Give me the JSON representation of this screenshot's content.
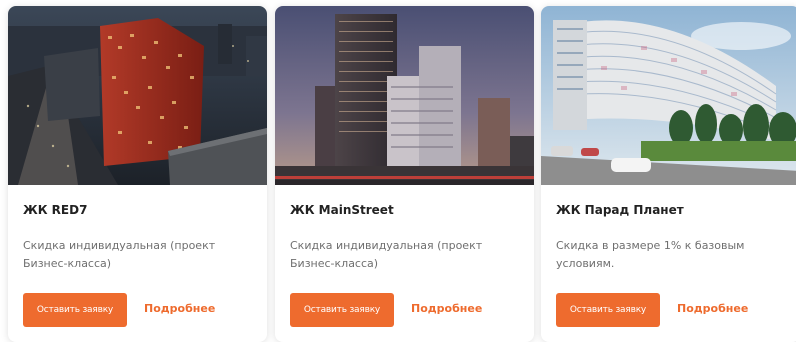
{
  "cards": [
    {
      "title": "ЖК RED7",
      "description": "Скидка индивидуальная (проект Бизнес-класса)",
      "button_label": "Оставить заявку",
      "link_label": "Подробнее",
      "image": "night-city-red-brick-tower-photo"
    },
    {
      "title": "ЖК MainStreet",
      "description": "Скидка индивидуальная (проект Бизнес-класса)",
      "button_label": "Оставить заявку",
      "link_label": "Подробнее",
      "image": "dusk-highrise-complex-photo"
    },
    {
      "title": "ЖК Парад Планет",
      "description": "Скидка в размере 1% к базовым условиям.",
      "button_label": "Оставить заявку",
      "link_label": "Подробнее",
      "image": "curved-colorful-residential-building-photo"
    }
  ],
  "colors": {
    "accent": "#ee6b2e",
    "title": "#222222",
    "text": "#6f6f6f"
  }
}
